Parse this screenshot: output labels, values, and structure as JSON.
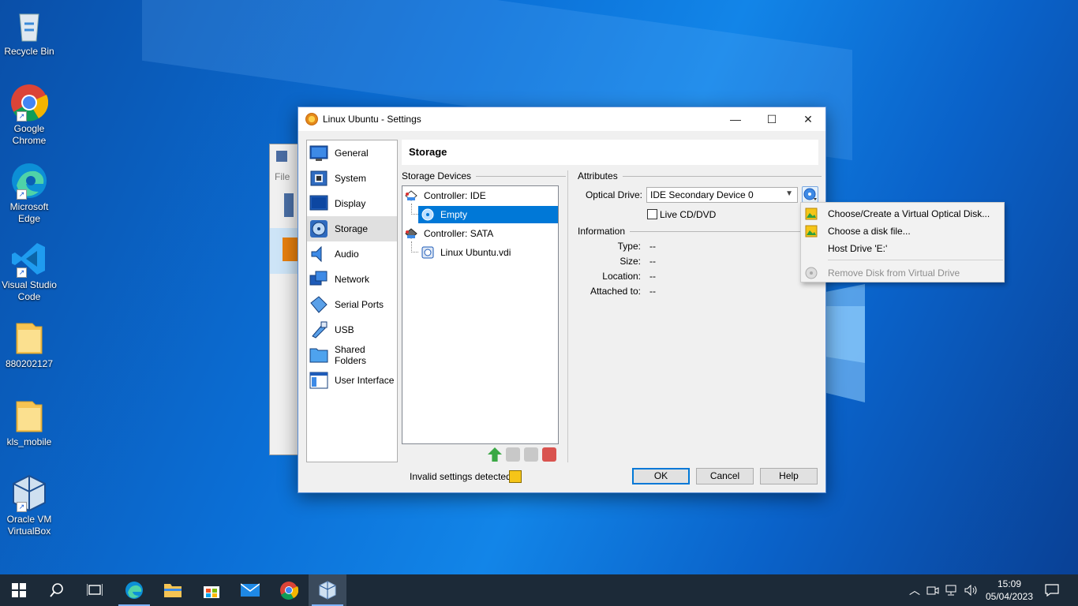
{
  "desktop": {
    "icons": [
      {
        "label": "Recycle Bin",
        "icon": "recycle-bin-icon"
      },
      {
        "label": "Google Chrome",
        "icon": "chrome-icon"
      },
      {
        "label": "Microsoft Edge",
        "icon": "edge-icon"
      },
      {
        "label": "Visual Studio Code",
        "icon": "vscode-icon"
      },
      {
        "label": "880202127",
        "icon": "folder-icon"
      },
      {
        "label": "kls_mobile",
        "icon": "folder-icon"
      },
      {
        "label": "Oracle VM VirtualBox",
        "icon": "virtualbox-icon"
      }
    ]
  },
  "back_window": {
    "menu_file": "File"
  },
  "dialog": {
    "title": "Linux Ubuntu - Settings",
    "window_controls": {
      "minimize": "—",
      "maximize": "☐",
      "close": "✕"
    },
    "sidebar": [
      {
        "label": "General",
        "icon": "general-icon"
      },
      {
        "label": "System",
        "icon": "system-icon"
      },
      {
        "label": "Display",
        "icon": "display-icon"
      },
      {
        "label": "Storage",
        "icon": "storage-icon",
        "selected": true
      },
      {
        "label": "Audio",
        "icon": "audio-icon"
      },
      {
        "label": "Network",
        "icon": "network-icon"
      },
      {
        "label": "Serial Ports",
        "icon": "serial-ports-icon"
      },
      {
        "label": "USB",
        "icon": "usb-icon"
      },
      {
        "label": "Shared Folders",
        "icon": "shared-folders-icon"
      },
      {
        "label": "User Interface",
        "icon": "user-interface-icon"
      }
    ],
    "header": "Storage",
    "storage_devices": {
      "title": "Storage Devices",
      "tree": [
        {
          "label": "Controller: IDE",
          "level": 0,
          "icon": "ide-controller-icon"
        },
        {
          "label": "Empty",
          "level": 1,
          "icon": "optical-disc-icon",
          "selected": true
        },
        {
          "label": "Controller: SATA",
          "level": 0,
          "icon": "sata-controller-icon"
        },
        {
          "label": "Linux Ubuntu.vdi",
          "level": 1,
          "icon": "hard-disk-icon"
        }
      ]
    },
    "attributes": {
      "title": "Attributes",
      "optical_drive_label": "Optical Drive:",
      "optical_drive_value": "IDE Secondary Device 0",
      "live_cd_label": "Live CD/DVD",
      "live_cd_checked": false
    },
    "information": {
      "title": "Information",
      "type_label": "Type:",
      "type_value": "--",
      "size_label": "Size:",
      "size_value": "--",
      "location_label": "Location:",
      "location_value": "--",
      "attached_label": "Attached to:",
      "attached_value": "--"
    },
    "status_text": "Invalid settings detected",
    "buttons": {
      "ok": "OK",
      "cancel": "Cancel",
      "help": "Help"
    }
  },
  "context_menu": {
    "items": [
      {
        "label": "Choose/Create a Virtual Optical Disk...",
        "enabled": true
      },
      {
        "label": "Choose a disk file...",
        "enabled": true
      },
      {
        "label": "Host Drive 'E:'",
        "enabled": true
      },
      {
        "label": "Remove Disk from Virtual Drive",
        "enabled": false
      }
    ]
  },
  "taskbar": {
    "time": "15:09",
    "date": "05/04/2023"
  },
  "colors": {
    "accent": "#0078d7",
    "taskbar": "#1c2a38"
  }
}
